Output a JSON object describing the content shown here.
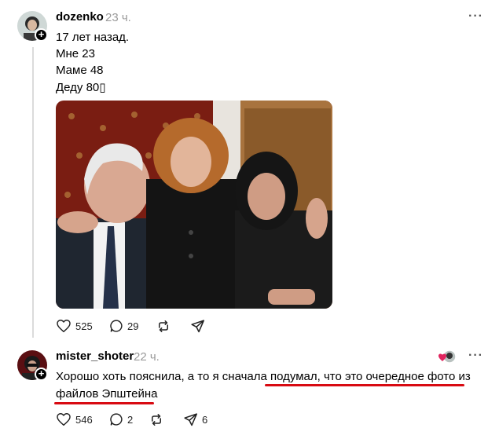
{
  "post": {
    "username": "dozenko",
    "time": "23 ч.",
    "lines": [
      "17 лет назад.",
      "Мне 23",
      "Маме 48",
      "Деду 80▯"
    ],
    "likes": "525",
    "comments": "29",
    "more": "···"
  },
  "reply": {
    "username": "mister_shoter",
    "time": "22 ч.",
    "text_part1": "Хорошо хоть пояснила, а то я сначала ",
    "text_part2": "подумал, что это очередное фото из",
    "text_line2": "файлов Эпштейна",
    "likes": "546",
    "comments": "2",
    "shares": "6",
    "more": "···"
  },
  "colors": {
    "underline": "#d80a12",
    "heart": "#e0245e"
  }
}
